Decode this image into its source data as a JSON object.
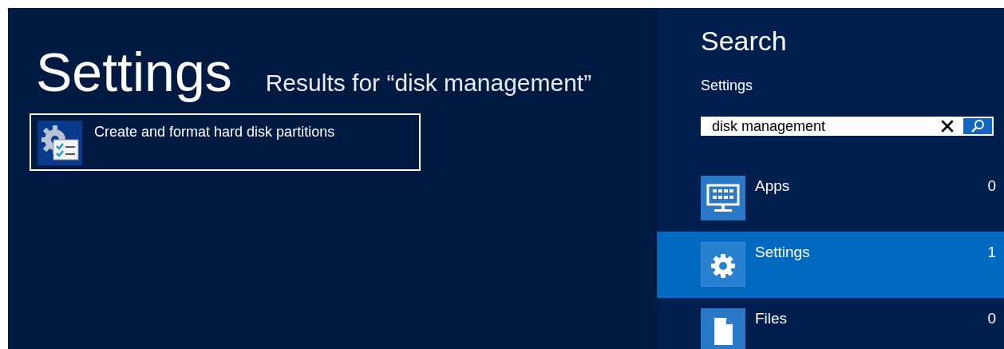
{
  "main": {
    "title": "Settings",
    "results_heading": "Results for “disk management”",
    "results": [
      {
        "label": "Create and format hard disk partitions",
        "selected": true
      }
    ]
  },
  "search_pane": {
    "title": "Search",
    "scope": "Settings",
    "search": {
      "value": "disk management"
    },
    "categories": [
      {
        "kind": "apps",
        "label": "Apps",
        "count": "0",
        "selected": false
      },
      {
        "kind": "settings",
        "label": "Settings",
        "count": "1",
        "selected": true
      },
      {
        "kind": "files",
        "label": "Files",
        "count": "0",
        "selected": false
      }
    ]
  }
}
